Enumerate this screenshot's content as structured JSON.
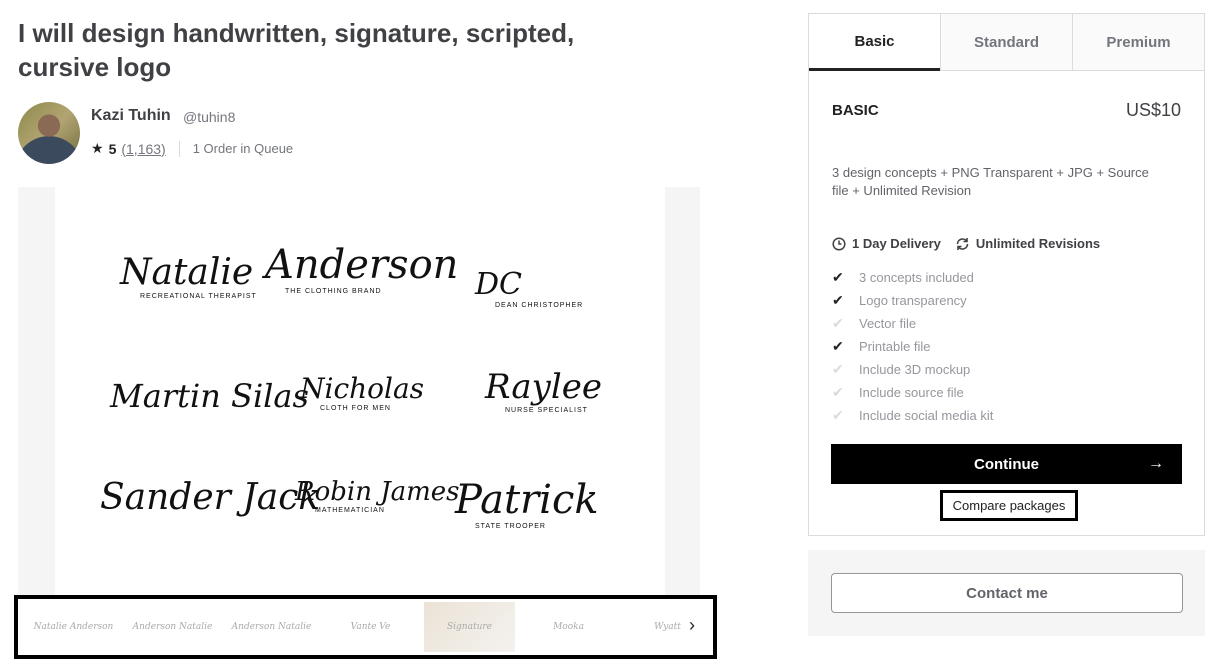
{
  "gig": {
    "title": "I will design handwritten, signature, scripted, cursive logo"
  },
  "seller": {
    "name": "Kazi Tuhin",
    "handle": "@tuhin8",
    "rating": "5",
    "reviews": "(1,163)",
    "queue": "1 Order in Queue"
  },
  "gallery": {
    "signatures": [
      {
        "name": "Natalie",
        "tag": "RECREATIONAL THERAPIST"
      },
      {
        "name": "Anderson",
        "tag": "THE CLOTHING BRAND"
      },
      {
        "name": "DC",
        "tag": "DEAN CHRISTOPHER"
      },
      {
        "name": "Martin Silas",
        "tag": ""
      },
      {
        "name": "Nicholas",
        "tag": "CLOTH FOR MEN"
      },
      {
        "name": "Raylee",
        "tag": "NURSE SPECIALIST"
      },
      {
        "name": "Sander Jack",
        "tag": ""
      },
      {
        "name": "Robin James",
        "tag": "MATHEMATICIAN"
      },
      {
        "name": "Patrick",
        "tag": "STATE TROOPER"
      }
    ],
    "thumbnails": [
      "Natalie Anderson",
      "Anderson Natalie",
      "Anderson Natalie",
      "Vante Ve",
      "Signature",
      "Mooka",
      "Wyatt"
    ],
    "next_icon": "chevron-right"
  },
  "packages": {
    "tabs": [
      "Basic",
      "Standard",
      "Premium"
    ],
    "active_tab": "Basic",
    "name": "BASIC",
    "price": "US$10",
    "description": "3 design concepts + PNG Transparent + JPG + Source file + Unlimited Revision",
    "delivery": "1 Day Delivery",
    "revisions": "Unlimited Revisions",
    "features": [
      {
        "label": "3 concepts included",
        "included": true
      },
      {
        "label": "Logo transparency",
        "included": true
      },
      {
        "label": "Vector file",
        "included": false
      },
      {
        "label": "Printable file",
        "included": true
      },
      {
        "label": "Include 3D mockup",
        "included": false
      },
      {
        "label": "Include source file",
        "included": false
      },
      {
        "label": "Include social media kit",
        "included": false
      }
    ],
    "continue_label": "Continue",
    "compare_label": "Compare packages"
  },
  "contact": {
    "label": "Contact me"
  }
}
